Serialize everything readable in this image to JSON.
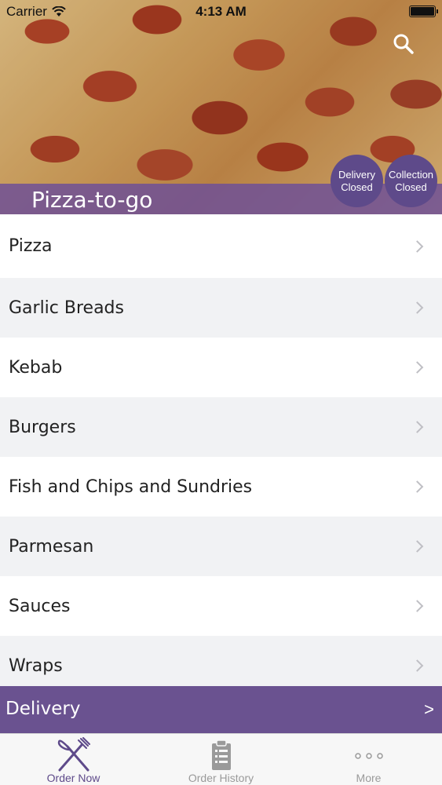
{
  "status_bar": {
    "carrier": "Carrier",
    "time": "4:13 AM"
  },
  "header": {
    "store_name": "Pizza-to-go"
  },
  "badges": {
    "delivery": {
      "line1": "Delivery",
      "line2": "Closed"
    },
    "collection": {
      "line1": "Collection",
      "line2": "Closed"
    }
  },
  "menu": {
    "items": [
      {
        "label": "Pizza"
      },
      {
        "label": "Garlic Breads"
      },
      {
        "label": "Kebab"
      },
      {
        "label": "Burgers"
      },
      {
        "label": "Fish and Chips and Sundries"
      },
      {
        "label": "Parmesan"
      },
      {
        "label": "Sauces"
      },
      {
        "label": "Wraps"
      }
    ]
  },
  "delivery_bar": {
    "label": "Delivery",
    "arrow": ">"
  },
  "tabs": [
    {
      "label": "Order Now",
      "icon": "fork-knife-icon",
      "active": true
    },
    {
      "label": "Order History",
      "icon": "clipboard-icon",
      "active": false
    },
    {
      "label": "More",
      "icon": "more-dots-icon",
      "active": false
    }
  ],
  "colors": {
    "accent": "#6a5290",
    "badge": "#5e4a8a",
    "row_alt": "#f1f2f4"
  }
}
